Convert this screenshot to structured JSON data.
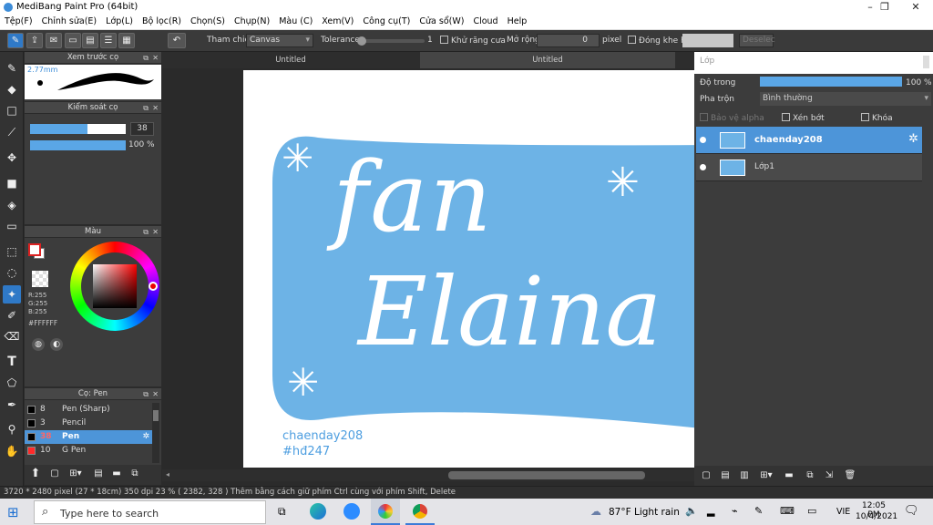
{
  "window": {
    "title": "MediBang Paint Pro (64bit)",
    "controls": [
      "–",
      "❐",
      "✕"
    ]
  },
  "menu": [
    "Tệp(F)",
    "Chỉnh sửa(E)",
    "Lớp(L)",
    "Bộ lọc(R)",
    "Chọn(S)",
    "Chụp(N)",
    "Màu (C)",
    "Xem(V)",
    "Công cụ(T)",
    "Cửa sổ(W)",
    "Cloud",
    "Help"
  ],
  "toolbar": {
    "refer_label": "Tham chiếu",
    "refer_value": "Canvas",
    "tolerance_label": "Tolerance",
    "tolerance_value": "1",
    "antialias_label": "Khử răng cưa",
    "expand_label": "Mở rộng",
    "expand_value": "0",
    "expand_unit": "pixel",
    "close_gap_label": "Đóng khe hở",
    "deselect_label": "Deselec"
  },
  "panels": {
    "preview": {
      "title": "Xem trước cọ",
      "size": "2.77mm"
    },
    "brush_control": {
      "title": "Kiểm soát cọ",
      "size_value": "38",
      "opacity_value": "100 %",
      "size_fill": 0.6,
      "opacity_fill": 1.0
    },
    "color": {
      "title": "Màu",
      "r": "R:255",
      "g": "G:255",
      "b": "B:255",
      "hex": "#FFFFFF"
    },
    "brush": {
      "title": "Cọ: Pen",
      "items": [
        {
          "size": "8",
          "name": "Pen (Sharp)",
          "color": "#000000",
          "selected": false
        },
        {
          "size": "3",
          "name": "Pencil",
          "color": "#000000",
          "selected": false
        },
        {
          "size": "38",
          "name": "Pen",
          "color": "#000000",
          "selected": true
        },
        {
          "size": "10",
          "name": "G Pen",
          "color": "#ff2a2a",
          "selected": false
        }
      ]
    }
  },
  "tabs": [
    "Untitled",
    "Untitled"
  ],
  "canvas": {
    "line1": "fan",
    "line2": "Elaina",
    "credit1": "chaenday208",
    "credit2": "#hđ247",
    "bg": "#6db3e6"
  },
  "layers": {
    "title": "Lớp",
    "opacity_label": "Độ trong",
    "opacity_value": "100 %",
    "blend_label": "Pha trộn",
    "blend_value": "Bình thường",
    "protect_alpha": "Bảo vệ alpha",
    "clipping": "Xén bớt",
    "lock": "Khóa",
    "items": [
      {
        "name": "chaenday208",
        "selected": true
      },
      {
        "name": "Lớp1",
        "selected": false
      }
    ]
  },
  "status": "3720 * 2480 pixel   (27 * 18cm)   350 dpi   23 %   ( 2382, 328 )   Thêm bằng cách giữ phím Ctrl cùng với phím Shift, Delete",
  "taskbar": {
    "search_placeholder": "Type here to search",
    "weather": "87°F  Light rain",
    "lang": "VIE",
    "time": "12:05 PM",
    "date": "10/4/2021"
  }
}
